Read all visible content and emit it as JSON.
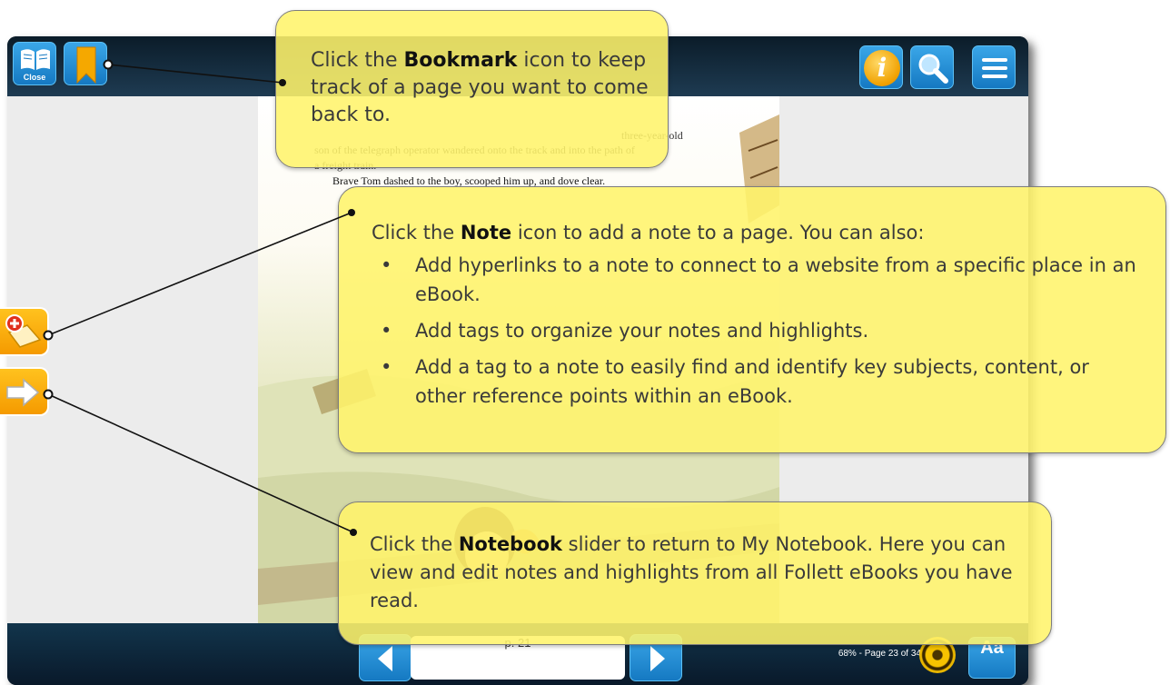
{
  "toolbar": {
    "close_label": "Close",
    "info_label": "i"
  },
  "book": {
    "text_lines": [
      "three-year-old",
      "son of the telegraph operator wandered onto the track and into the path of",
      "a freight train.",
      "Brave Tom dashed to the boy, scooped him up, and dove clear."
    ]
  },
  "footer": {
    "page_field": "p. 21",
    "progress": "68% - Page 23 of 34",
    "font_button": "Aa"
  },
  "callouts": {
    "bookmark": {
      "pre": "Click the ",
      "bold": "Bookmark",
      "post": " icon to keep track of a page you want to come back to."
    },
    "note": {
      "pre": "Click the ",
      "bold": "Note",
      "post": " icon to add a note to a page. You can also:",
      "bullets": [
        "Add hyperlinks to a note to connect to a website from a specific place in an eBook.",
        "Add tags to organize your notes and highlights.",
        "Add a tag to a note to easily find and identify key subjects, content, or other reference points within an eBook."
      ]
    },
    "notebook": {
      "pre": "Click the ",
      "bold": "Notebook",
      "post": " slider to return to My Notebook. Here you can view and edit notes and highlights from all Follett eBooks you have read."
    }
  },
  "colors": {
    "callout_fill": "#fff46b",
    "accent_orange": "#f59a00",
    "toolbar_blue": "#1579c2"
  }
}
